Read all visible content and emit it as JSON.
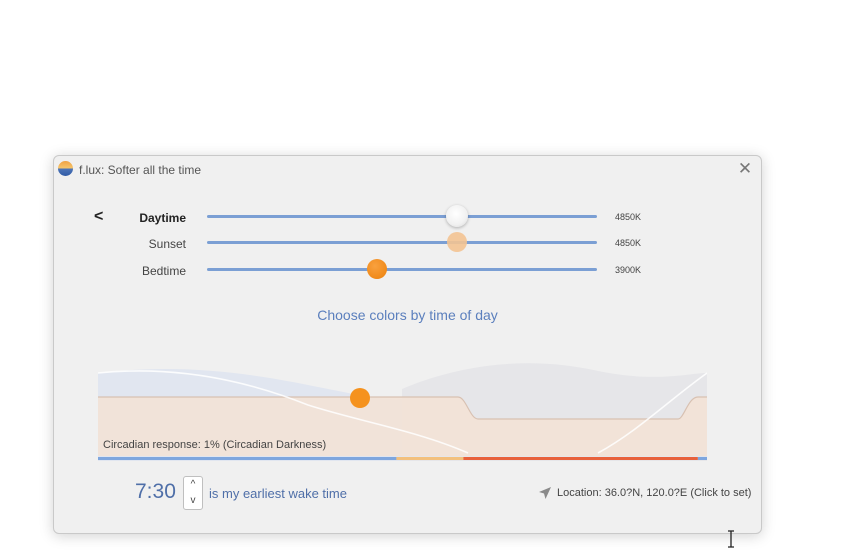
{
  "window": {
    "title": "f.lux: Softer all the time",
    "close_glyph": "✕"
  },
  "nav": {
    "back_glyph": "<"
  },
  "sliders": [
    {
      "label": "Daytime",
      "value_text": "4850K",
      "position_fraction": 0.64,
      "thumb": "white"
    },
    {
      "label": "Sunset",
      "value_text": "4850K",
      "position_fraction": 0.64,
      "thumb": "peach"
    },
    {
      "label": "Bedtime",
      "value_text": "3900K",
      "position_fraction": 0.435,
      "thumb": "orange"
    }
  ],
  "choose_colors_link": "Choose colors by time of day",
  "schedule": {
    "circadian_text": "Circadian response: 1% (Circadian Darkness)",
    "timeline_segments": [
      {
        "color": "#7fa6de",
        "fraction": 0.49
      },
      {
        "color": "#f3c07d",
        "fraction": 0.11
      },
      {
        "color": "#e8613b",
        "fraction": 0.385
      },
      {
        "color": "#7fa6de",
        "fraction": 0.015
      }
    ]
  },
  "wake": {
    "time": "7:30",
    "stepper_up": "^",
    "stepper_down": "v",
    "label": "is my earliest wake time"
  },
  "location": {
    "text": "Location: 36.0?N, 120.0?E (Click to set)",
    "icon": "location-arrow-icon"
  },
  "colors": {
    "accent_blue": "#5b7fbd",
    "slider_track": "#7b9fd4",
    "bedtime_orange": "#f08a1a"
  }
}
